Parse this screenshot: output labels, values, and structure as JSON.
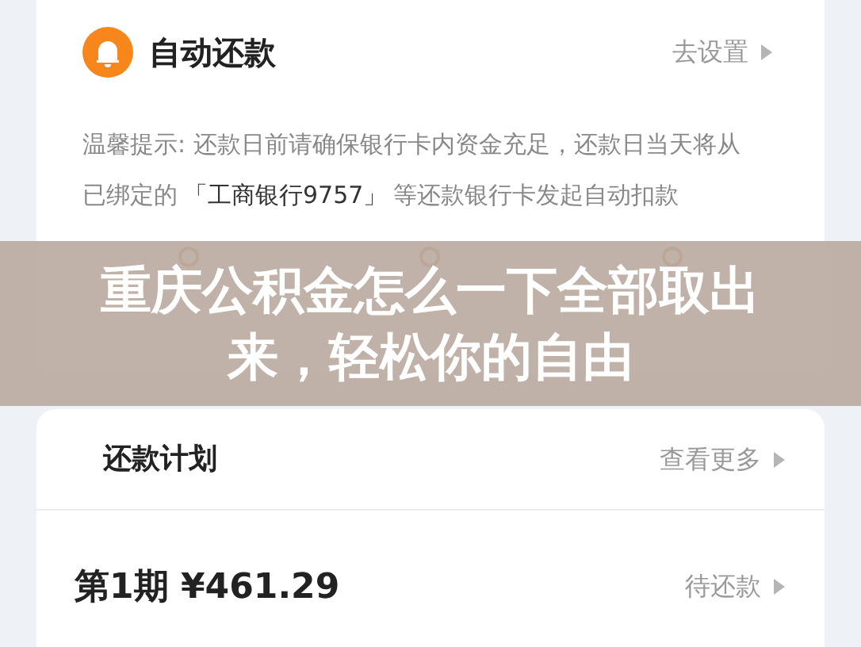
{
  "auto_repay": {
    "title": "自动还款",
    "action": "去设置",
    "hint_prefix": "温馨提示: 还款日前请确保银行卡内资金充足，还款日当天将从已绑定的",
    "bank": "「工商银行9757」",
    "hint_suffix": "等还款银行卡发起自动扣款",
    "shortcuts": [
      {
        "kind": "ring"
      },
      {
        "kind": "ring"
      },
      {
        "kind": "ring"
      }
    ]
  },
  "banner": {
    "title": "重庆公积金怎么一下全部取出来，轻松你的自由"
  },
  "plan": {
    "title": "还款计划",
    "action": "查看更多",
    "installment": "第1期 ¥461.29",
    "status": "待还款"
  }
}
